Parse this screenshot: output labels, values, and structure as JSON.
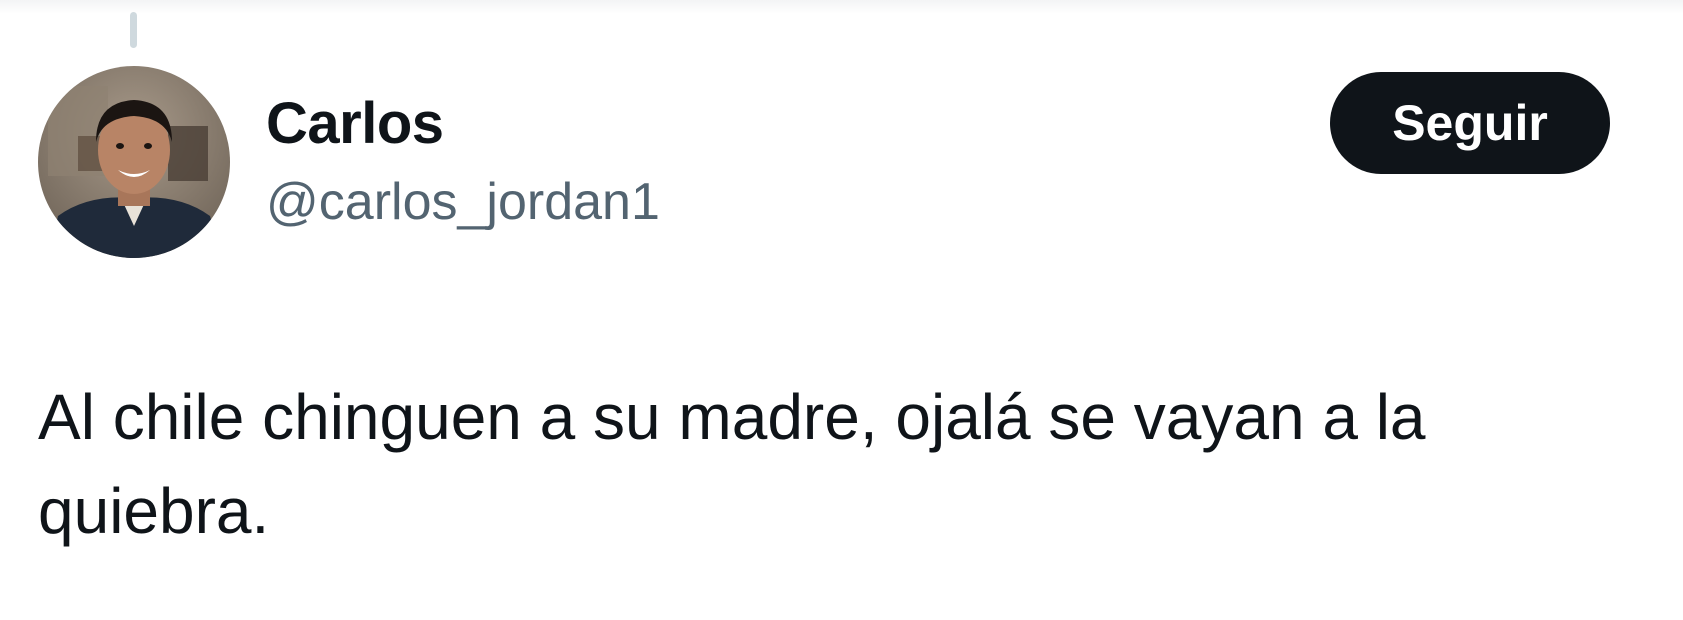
{
  "author": {
    "display_name": "Carlos",
    "handle": "@carlos_jordan1",
    "avatar_icon": "profile-photo"
  },
  "actions": {
    "follow_label": "Seguir"
  },
  "tweet": {
    "text": "Al chile chinguen a su madre, ojalá se vayan a la quiebra."
  },
  "colors": {
    "text_primary": "#0f1419",
    "text_secondary": "#536471",
    "button_bg": "#0f1419",
    "button_text": "#ffffff",
    "thread_line": "#cfd9de"
  }
}
